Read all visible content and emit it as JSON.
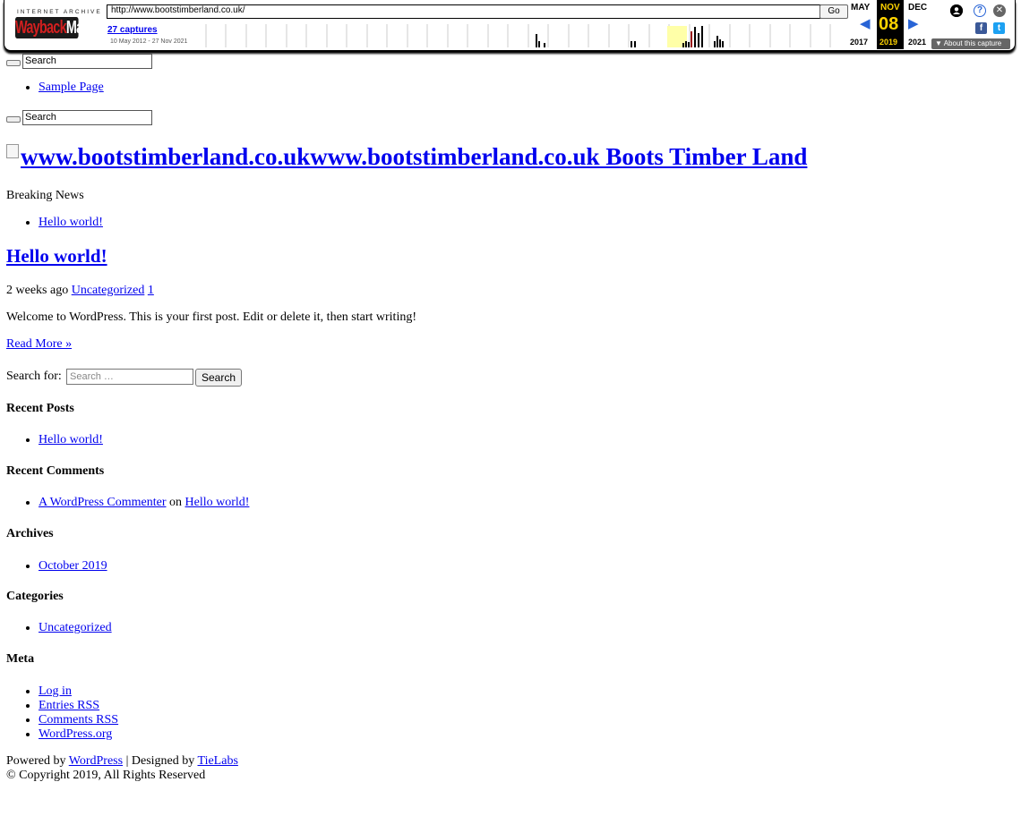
{
  "wayback": {
    "logo_top": "INTERNET ARCHIVE",
    "logo_way": "Wayback",
    "logo_machine": "Machine",
    "url": "http://www.bootstimberland.co.uk/",
    "go_label": "Go",
    "captures": "27 captures",
    "range": "10 May 2012 - 27 Nov 2021",
    "prev_month": "MAY",
    "cur_month": "NOV",
    "next_month": "DEC",
    "cur_day": "08",
    "prev_year": "2017",
    "cur_year": "2019",
    "next_year": "2021",
    "about": "About this capture",
    "arrow_prev": "◀",
    "arrow_next": "▶",
    "icons": {
      "account": "user-icon",
      "help": "help-icon",
      "close": "close-icon",
      "facebook": "facebook-icon",
      "twitter": "twitter-icon"
    },
    "colors": {
      "accent": "#2864d6",
      "highlight": "#ffd400",
      "facebook": "#3b5998",
      "twitter": "#1da1f2"
    }
  },
  "header": {
    "search1_value": "Search",
    "nav_items": [
      "Sample Page"
    ],
    "search2_value": "Search",
    "site_title": "www.bootstimberland.co.ukwww.bootstimberland.co.uk Boots Timber Land"
  },
  "breaking": {
    "label": "Breaking News",
    "items": [
      "Hello world!"
    ]
  },
  "post": {
    "title": "Hello world!",
    "time_ago": "2 weeks ago",
    "category": "Uncategorized",
    "comments_count": "1",
    "excerpt": "Welcome to WordPress. This is your first post. Edit or delete it, then start writing!",
    "read_more": "Read More »"
  },
  "search_form": {
    "label": "Search for:",
    "placeholder": "Search …",
    "button": "Search"
  },
  "sidebar": {
    "recent_posts_title": "Recent Posts",
    "recent_posts": [
      "Hello world!"
    ],
    "recent_comments_title": "Recent Comments",
    "comment_author": "A WordPress Commenter",
    "comment_on": "on",
    "comment_post": "Hello world!",
    "archives_title": "Archives",
    "archives": [
      "October 2019"
    ],
    "categories_title": "Categories",
    "categories": [
      "Uncategorized"
    ],
    "meta_title": "Meta",
    "meta": [
      "Log in",
      "Entries RSS",
      "Comments RSS",
      "WordPress.org"
    ]
  },
  "footer": {
    "powered_by": "Powered by",
    "wordpress": "WordPress",
    "designed_by": "| Designed by",
    "tielabs": "TieLabs",
    "copyright": "© Copyright 2019, All Rights Reserved"
  }
}
